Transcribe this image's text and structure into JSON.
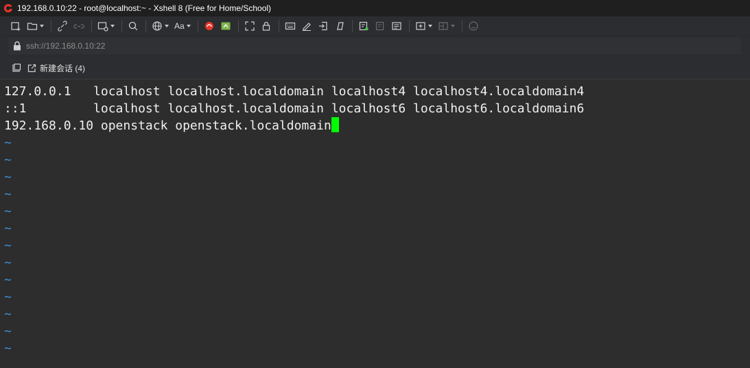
{
  "window": {
    "title": "192.168.0.10:22 - root@localhost:~ - Xshell 8 (Free for Home/School)"
  },
  "toolbar": {
    "font_label": "Aa",
    "icons": [
      "new-session-icon",
      "open-folder-icon",
      "connect-icon",
      "disconnect-icon",
      "new-window-icon",
      "search-icon",
      "globe-icon",
      "font-icon",
      "xftp-icon",
      "xshell-plus-icon",
      "fullscreen-icon",
      "lock-icon",
      "keyboard-icon",
      "script-icon",
      "transfer-icon",
      "compose-icon",
      "record-icon",
      "send-icon",
      "compose-bar-icon",
      "add-tab-icon",
      "layout-icon",
      "help-icon"
    ]
  },
  "address": {
    "value": "ssh://192.168.0.10:22"
  },
  "tabs": {
    "new_session_label": "新建会话 (4)"
  },
  "terminal": {
    "lines": [
      "127.0.0.1   localhost localhost.localdomain localhost4 localhost4.localdomain4",
      "::1         localhost localhost.localdomain localhost6 localhost6.localdomain6",
      "192.168.0.10 openstack openstack.localdomain"
    ],
    "tilde": "~",
    "tilde_count": 13,
    "cursor_color": "#00ff00",
    "tilde_color": "#3b8fd6"
  }
}
